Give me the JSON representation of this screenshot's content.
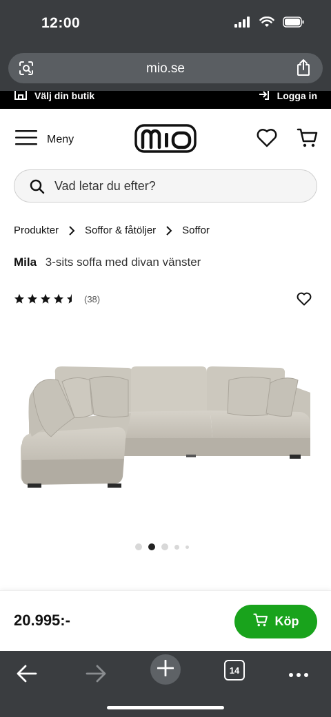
{
  "status": {
    "time": "12:00"
  },
  "browser": {
    "url": "mio.se",
    "tab_count": "14"
  },
  "top_strip": {
    "store_label": "Välj din butik",
    "login_label": "Logga in"
  },
  "header": {
    "menu_label": "Meny",
    "logo_text": "mio"
  },
  "search": {
    "placeholder": "Vad letar du efter?"
  },
  "breadcrumb": [
    "Produkter",
    "Soffor & fåtöljer",
    "Soffor"
  ],
  "product": {
    "name": "Mila",
    "description": "3-sits soffa med divan vänster",
    "rating": 4.5,
    "review_count": "(38)",
    "image_count": 5,
    "active_image": 2
  },
  "buy": {
    "price": "20.995:-",
    "button_label": "Köp"
  },
  "colors": {
    "accent_green": "#19a31c",
    "browser_chrome": "#3a3d40"
  },
  "icons": {
    "status": [
      "cellular-icon",
      "wifi-icon",
      "battery-icon"
    ],
    "header": [
      "hamburger-icon",
      "heart-icon",
      "cart-icon"
    ],
    "toolbar": [
      "back-icon",
      "forward-icon",
      "plus-icon",
      "tabs-icon",
      "more-icon"
    ]
  }
}
